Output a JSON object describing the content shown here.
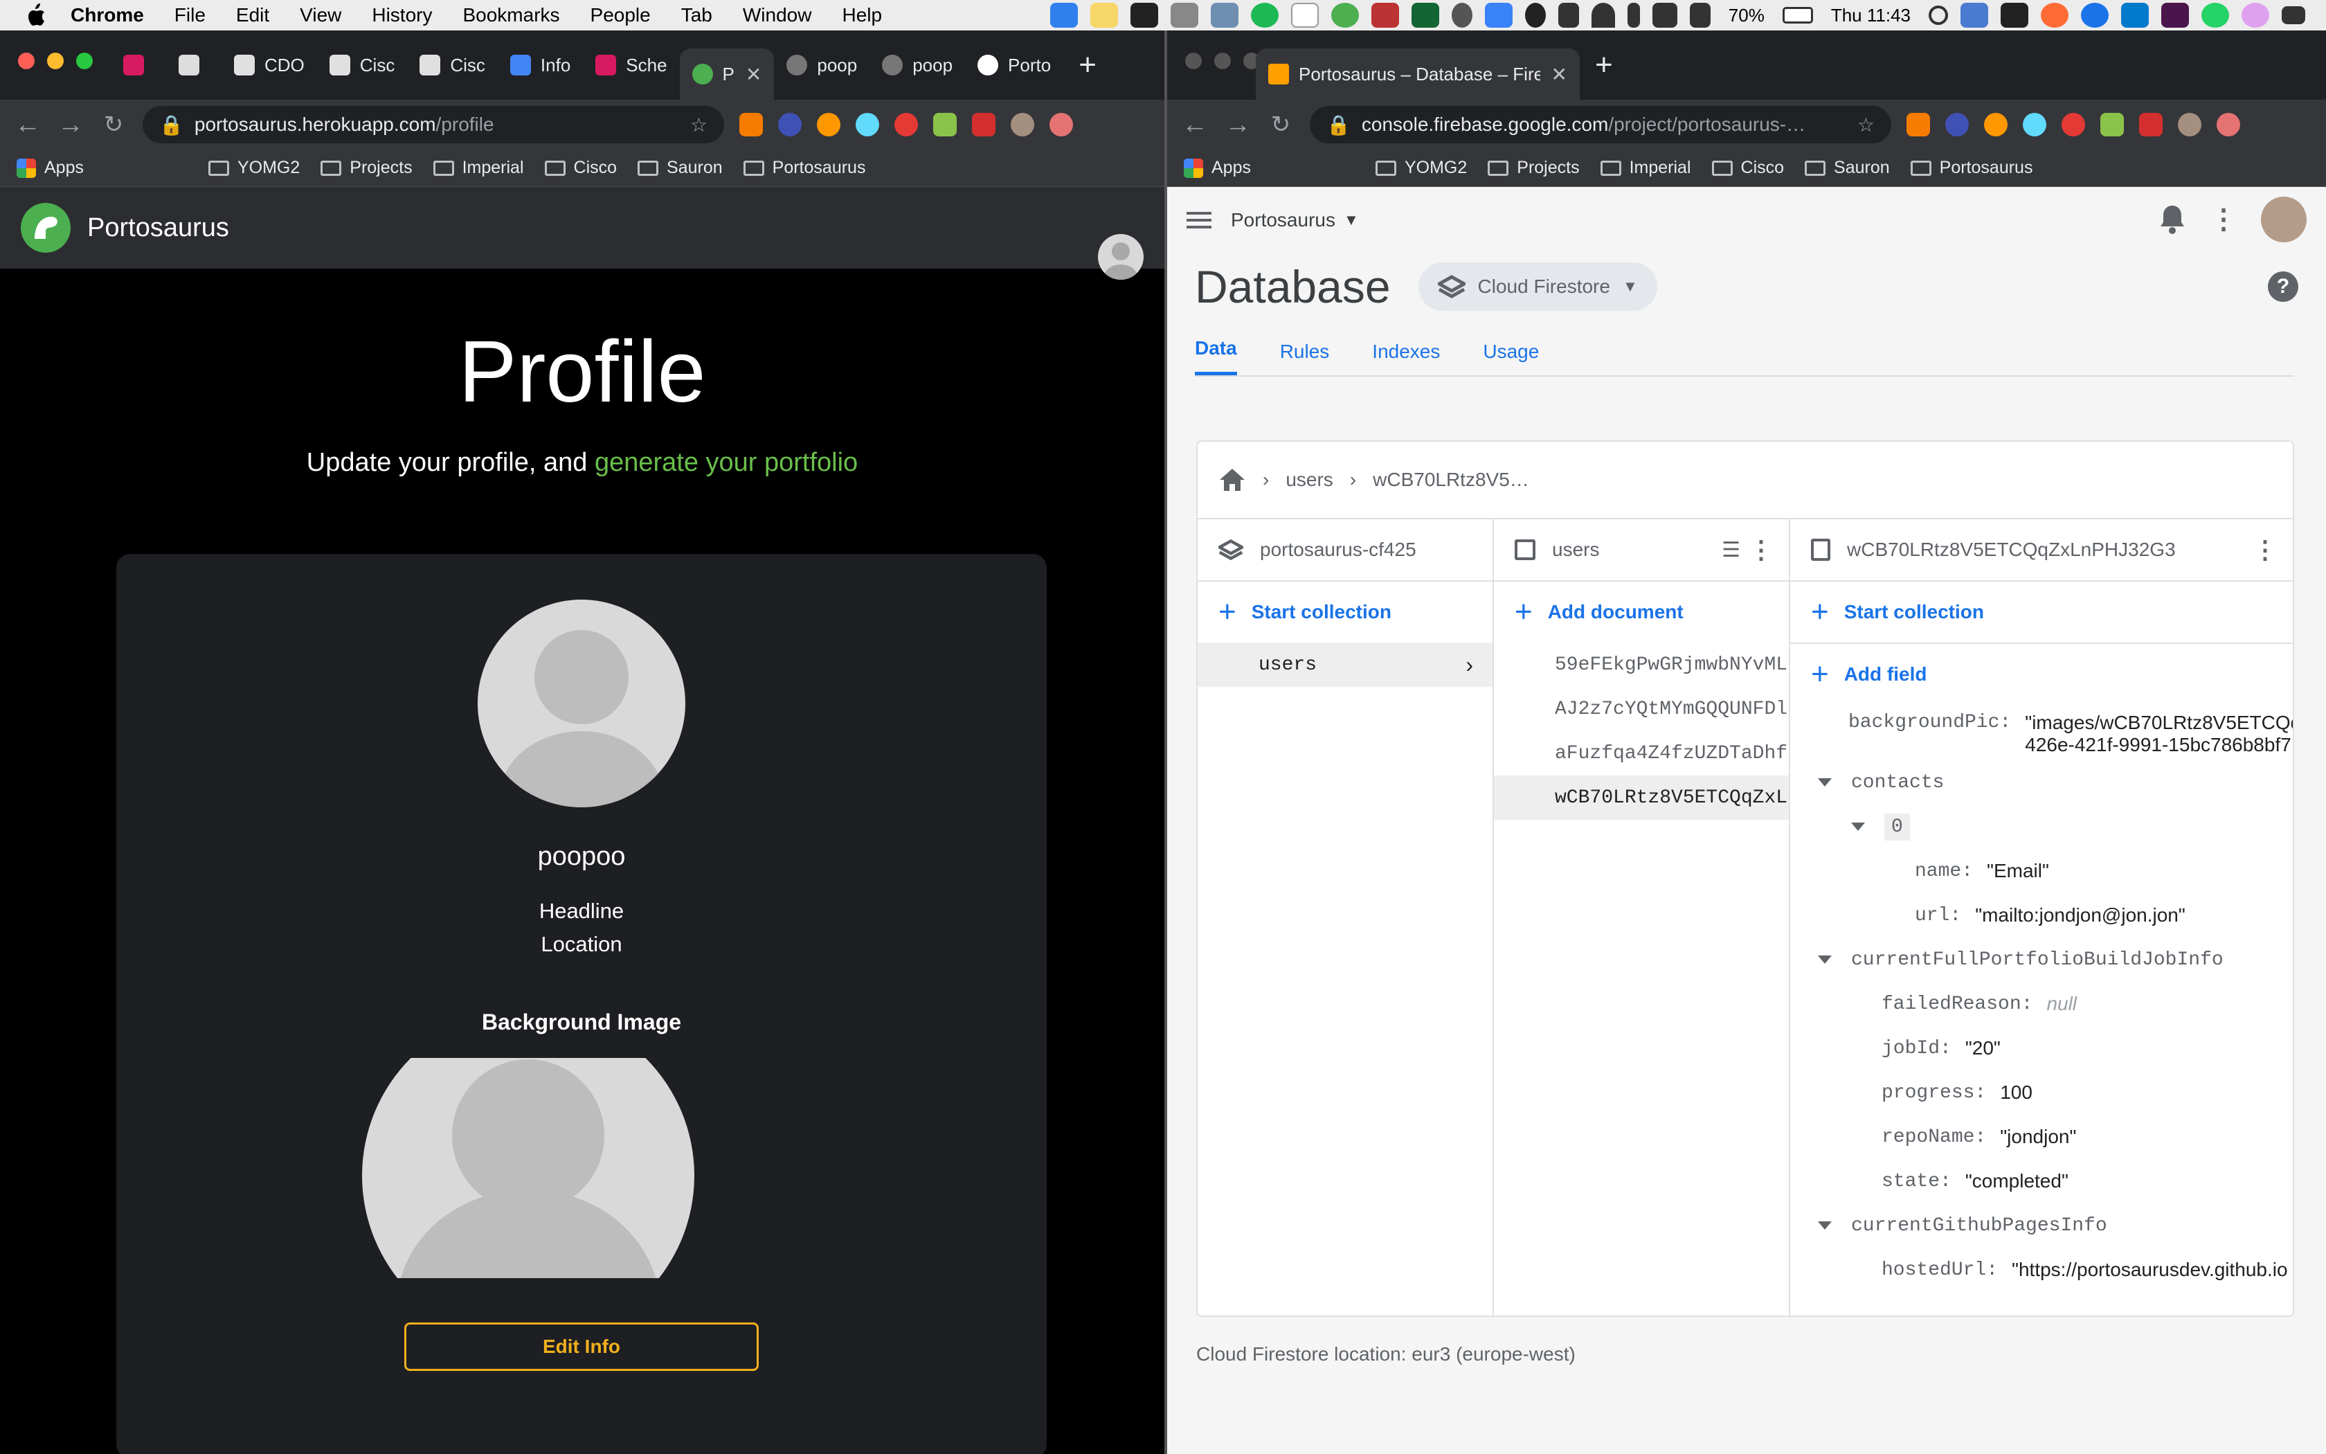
{
  "menubar": {
    "app": "Chrome",
    "items": [
      "File",
      "Edit",
      "View",
      "History",
      "Bookmarks",
      "People",
      "Tab",
      "Window",
      "Help"
    ],
    "battery": "70%",
    "clock": "Thu 11:43"
  },
  "left_window": {
    "tabs": [
      {
        "label": ""
      },
      {
        "label": ""
      },
      {
        "label": "CDO"
      },
      {
        "label": "Cisc"
      },
      {
        "label": "Cisc"
      },
      {
        "label": "Info"
      },
      {
        "label": "Sche"
      },
      {
        "label": "P"
      },
      {
        "label": "poop"
      },
      {
        "label": "poop"
      },
      {
        "label": "Porto"
      }
    ],
    "url_host": "portosaurus.herokuapp.com",
    "url_path": "/profile",
    "bookmarks": [
      "Apps",
      "YOMG2",
      "Projects",
      "Imperial",
      "Cisco",
      "Sauron",
      "Portosaurus"
    ]
  },
  "portosaurus": {
    "brand": "Portosaurus",
    "title": "Profile",
    "subtitle_prefix": "Update your profile, and ",
    "subtitle_link": "generate your portfolio",
    "name": "poopoo",
    "headline": "Headline",
    "location": "Location",
    "background_label": "Background Image",
    "edit_button": "Edit Info",
    "accent": "#6abf4b",
    "button_color": "#f2b01e"
  },
  "right_window": {
    "tab_title": "Portosaurus – Database – Fireb",
    "url_host": "console.firebase.google.com",
    "url_path": "/project/portosaurus-…",
    "bookmarks": [
      "Apps",
      "YOMG2",
      "Projects",
      "Imperial",
      "Cisco",
      "Sauron",
      "Portosaurus"
    ]
  },
  "firebase": {
    "project": "Portosaurus",
    "title": "Database",
    "db_chip": "Cloud Firestore",
    "tabs": [
      "Data",
      "Rules",
      "Indexes",
      "Usage"
    ],
    "breadcrumb": [
      "users",
      "wCB70LRtz8V5…"
    ],
    "col1": {
      "header": "portosaurus-cf425",
      "action": "Start collection",
      "items": [
        "users"
      ]
    },
    "col2": {
      "header": "users",
      "action": "Add document",
      "items": [
        "59eFEkgPwGRjmwbNYvML",
        "AJ2z7cYQtMYmGQQUNFDl",
        "aFuzfqa4Z4fzUZDTaDhf",
        "wCB70LRtz8V5ETCQqZxL"
      ]
    },
    "col3": {
      "header": "wCB70LRtz8V5ETCQqZxLnPHJ32G3",
      "action": "Start collection",
      "add_field": "Add field",
      "fields": {
        "backgroundPic_key": "backgroundPic:",
        "backgroundPic_line1": "\"images/wCB70LRtz8V5ETCQq",
        "backgroundPic_line2": "426e-421f-9991-15bc786b8bf7",
        "contacts_key": "contacts",
        "contacts_index": "0",
        "contact_name_key": "name:",
        "contact_name_val": "\"Email\"",
        "contact_url_key": "url:",
        "contact_url_val": "\"mailto:jondjon@jon.jon\"",
        "build_key": "currentFullPortfolioBuildJobInfo",
        "failed_key": "failedReason:",
        "failed_val": "null",
        "jobid_key": "jobId:",
        "jobid_val": "\"20\"",
        "progress_key": "progress:",
        "progress_val": "100",
        "repo_key": "repoName:",
        "repo_val": "\"jondjon\"",
        "state_key": "state:",
        "state_val": "\"completed\"",
        "pages_key": "currentGithubPagesInfo",
        "hosted_key": "hostedUrl:",
        "hosted_val": "\"https://portosaurusdev.github.io"
      }
    },
    "footer": "Cloud Firestore location: eur3 (europe-west)"
  }
}
